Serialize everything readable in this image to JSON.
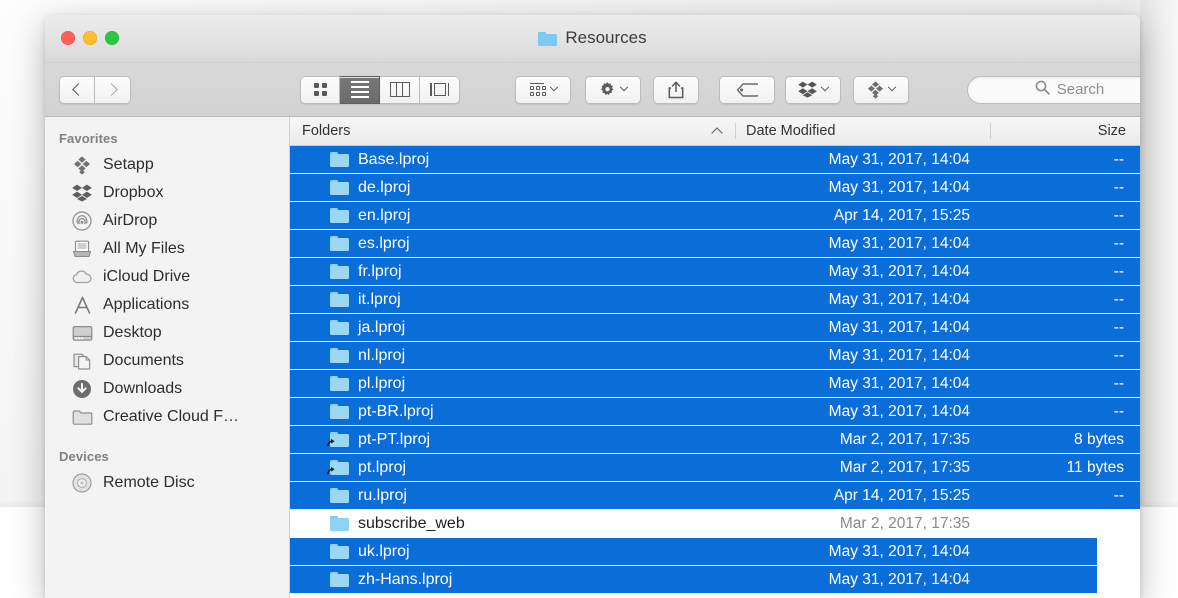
{
  "window": {
    "title": "Resources",
    "title_icon": "folder-icon",
    "traffic_lights": [
      "close-button",
      "minimize-button",
      "zoom-button"
    ]
  },
  "toolbar": {
    "back_label": "Back",
    "forward_label": "Forward",
    "view_modes": [
      {
        "name": "icon-view",
        "icon": "grid-icon",
        "active": false
      },
      {
        "name": "list-view",
        "icon": "list-icon",
        "active": true
      },
      {
        "name": "column-view",
        "icon": "columns-icon",
        "active": false
      },
      {
        "name": "gallery-view",
        "icon": "gallery-icon",
        "active": false
      }
    ],
    "arrange_label": "Arrange",
    "action_label": "Action",
    "share_label": "Share",
    "tag_label": "Edit Tags",
    "dropbox_label": "Dropbox",
    "setapp_label": "Setapp"
  },
  "search": {
    "placeholder": "Search",
    "value": "",
    "icon": "search-icon"
  },
  "sidebar": {
    "sections": [
      {
        "header": "Favorites",
        "items": [
          {
            "label": "Setapp",
            "icon": "setapp-icon"
          },
          {
            "label": "Dropbox",
            "icon": "dropbox-icon"
          },
          {
            "label": "AirDrop",
            "icon": "airdrop-icon"
          },
          {
            "label": "All My Files",
            "icon": "all-my-files-icon"
          },
          {
            "label": "iCloud Drive",
            "icon": "icloud-icon"
          },
          {
            "label": "Applications",
            "icon": "applications-icon"
          },
          {
            "label": "Desktop",
            "icon": "desktop-icon"
          },
          {
            "label": "Documents",
            "icon": "documents-icon"
          },
          {
            "label": "Downloads",
            "icon": "downloads-icon"
          },
          {
            "label": "Creative Cloud F…",
            "icon": "folder-icon"
          }
        ]
      },
      {
        "header": "Devices",
        "items": [
          {
            "label": "Remote Disc",
            "icon": "disc-icon"
          }
        ]
      }
    ]
  },
  "file_list": {
    "columns": [
      "Folders",
      "Date Modified",
      "Size"
    ],
    "sort_column": "Folders",
    "sort_direction": "ascending",
    "rows": [
      {
        "name": "Base.lproj",
        "date": "May 31, 2017, 14:04",
        "size": "--",
        "selected": true,
        "alias": false,
        "narrow": false
      },
      {
        "name": "de.lproj",
        "date": "May 31, 2017, 14:04",
        "size": "--",
        "selected": true,
        "alias": false,
        "narrow": false
      },
      {
        "name": "en.lproj",
        "date": "Apr 14, 2017, 15:25",
        "size": "--",
        "selected": true,
        "alias": false,
        "narrow": false
      },
      {
        "name": "es.lproj",
        "date": "May 31, 2017, 14:04",
        "size": "--",
        "selected": true,
        "alias": false,
        "narrow": false
      },
      {
        "name": "fr.lproj",
        "date": "May 31, 2017, 14:04",
        "size": "--",
        "selected": true,
        "alias": false,
        "narrow": false
      },
      {
        "name": "it.lproj",
        "date": "May 31, 2017, 14:04",
        "size": "--",
        "selected": true,
        "alias": false,
        "narrow": false
      },
      {
        "name": "ja.lproj",
        "date": "May 31, 2017, 14:04",
        "size": "--",
        "selected": true,
        "alias": false,
        "narrow": false
      },
      {
        "name": "nl.lproj",
        "date": "May 31, 2017, 14:04",
        "size": "--",
        "selected": true,
        "alias": false,
        "narrow": false
      },
      {
        "name": "pl.lproj",
        "date": "May 31, 2017, 14:04",
        "size": "--",
        "selected": true,
        "alias": false,
        "narrow": false
      },
      {
        "name": "pt-BR.lproj",
        "date": "May 31, 2017, 14:04",
        "size": "--",
        "selected": true,
        "alias": false,
        "narrow": false
      },
      {
        "name": "pt-PT.lproj",
        "date": "Mar 2, 2017, 17:35",
        "size": "8 bytes",
        "selected": true,
        "alias": true,
        "narrow": false
      },
      {
        "name": "pt.lproj",
        "date": "Mar 2, 2017, 17:35",
        "size": "11 bytes",
        "selected": true,
        "alias": true,
        "narrow": false
      },
      {
        "name": "ru.lproj",
        "date": "Apr 14, 2017, 15:25",
        "size": "--",
        "selected": true,
        "alias": false,
        "narrow": false
      },
      {
        "name": "subscribe_web",
        "date": "Mar 2, 2017, 17:35",
        "size": "",
        "selected": false,
        "alias": false,
        "narrow": false
      },
      {
        "name": "uk.lproj",
        "date": "May 31, 2017, 14:04",
        "size": "",
        "selected": true,
        "alias": false,
        "narrow": true
      },
      {
        "name": "zh-Hans.lproj",
        "date": "May 31, 2017, 14:04",
        "size": "",
        "selected": true,
        "alias": false,
        "narrow": true
      }
    ]
  },
  "colors": {
    "selection_blue": "#0b6ed8",
    "folder_blue": "#8ed3f3",
    "titlebar_grey": "#e3e3e3",
    "sidebar_grey": "#f3f3f3"
  }
}
